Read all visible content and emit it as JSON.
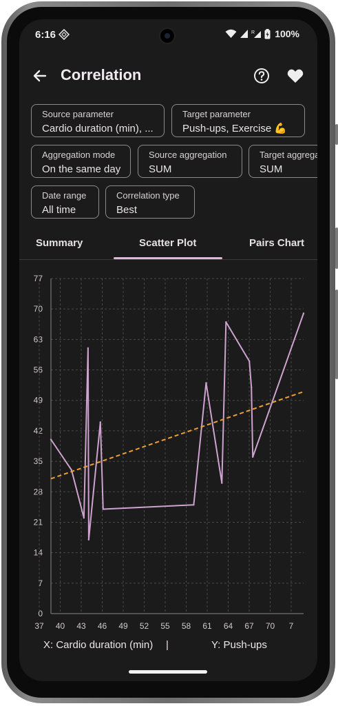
{
  "status": {
    "time": "6:16",
    "battery": "100%"
  },
  "appbar": {
    "title": "Correlation"
  },
  "filters": {
    "source_parameter": {
      "label": "Source parameter",
      "value": "Cardio duration (min), ..."
    },
    "target_parameter": {
      "label": "Target parameter",
      "value": "Push-ups, Exercise 💪"
    },
    "aggregation_mode": {
      "label": "Aggregation mode",
      "value": "On the same day"
    },
    "source_aggregation": {
      "label": "Source aggregation",
      "value": "SUM"
    },
    "target_aggregation": {
      "label": "Target aggregation",
      "value": "SUM"
    },
    "date_range": {
      "label": "Date range",
      "value": "All time"
    },
    "correlation_type": {
      "label": "Correlation type",
      "value": "Best"
    }
  },
  "tabs": [
    {
      "label": "Summary"
    },
    {
      "label": "Scatter Plot",
      "selected": true
    },
    {
      "label": "Pairs Chart"
    }
  ],
  "chart_data": {
    "type": "line",
    "xlabel": "X: Cardio duration (min)",
    "ylabel": "Y: Push-ups",
    "xlim": [
      35.7,
      72.5
    ],
    "ylim": [
      0,
      77
    ],
    "x_ticks": [
      "37",
      "40",
      "43",
      "46",
      "49",
      "52",
      "55",
      "58",
      "61",
      "64",
      "67",
      "70",
      "7"
    ],
    "y_ticks": [
      "0",
      "7",
      "14",
      "21",
      "28",
      "35",
      "42",
      "49",
      "56",
      "63",
      "70",
      "77"
    ],
    "grid": true,
    "series": [
      {
        "color": "#cfa3cf",
        "points": [
          [
            35.7,
            40
          ],
          [
            38.7,
            33
          ],
          [
            40.5,
            22
          ],
          [
            41.1,
            61
          ],
          [
            41.2,
            17
          ],
          [
            42.9,
            44
          ],
          [
            43.3,
            24
          ],
          [
            56.5,
            25
          ],
          [
            58.3,
            53
          ],
          [
            60.6,
            30
          ],
          [
            61.2,
            67
          ],
          [
            64.6,
            58
          ],
          [
            64.9,
            52
          ],
          [
            65.1,
            36
          ],
          [
            72.5,
            69
          ]
        ]
      }
    ],
    "trendline": {
      "color": "#f0a030",
      "points": [
        [
          35.7,
          31
        ],
        [
          72.5,
          51
        ]
      ]
    }
  },
  "axis_captions": {
    "x": "X: Cardio duration (min)",
    "separator": "|",
    "y": "Y: Push-ups"
  }
}
